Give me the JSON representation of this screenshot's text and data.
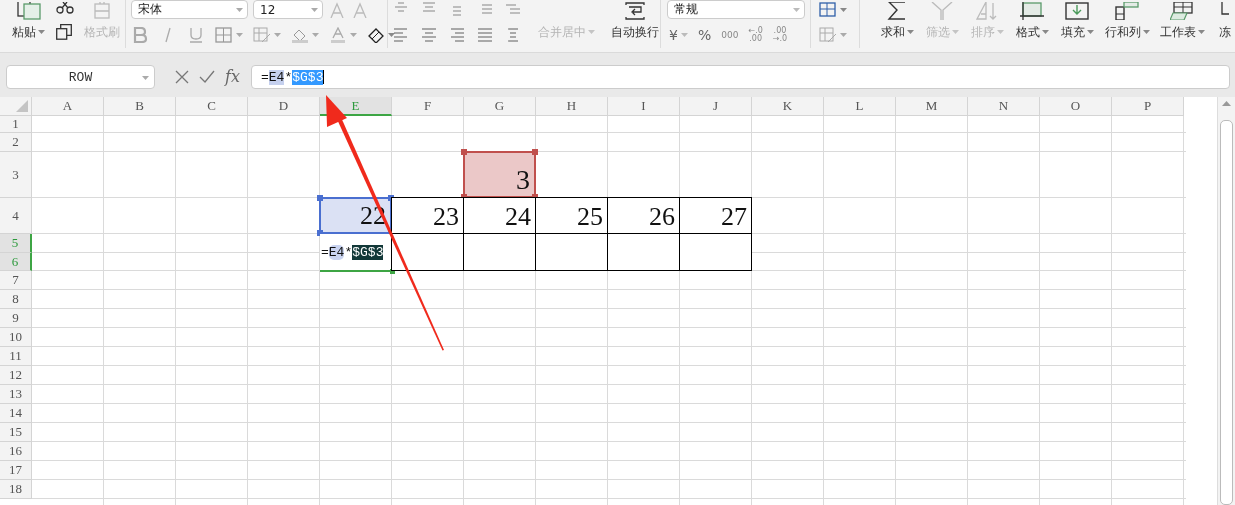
{
  "ribbon": {
    "clipboard": {
      "paste": {
        "label": "粘贴",
        "dropdown": true,
        "disabled": false
      },
      "format_painter": {
        "label": "格式刷",
        "dropdown": false,
        "disabled": true
      }
    },
    "font": {
      "name": "宋体",
      "size": "12"
    },
    "alignment": {
      "merge_center": {
        "label": "合并居中",
        "dropdown": true,
        "disabled": true
      },
      "wrap_text": {
        "label": "自动换行",
        "dropdown": false,
        "disabled": false
      }
    },
    "number": {
      "format": "常规",
      "currency": "¥",
      "percent": "%",
      "thousands": "000",
      "increase_decimal": {
        "top": "←.0",
        "bottom": ".00"
      },
      "decrease_decimal": {
        "top": ".00",
        "bottom": "→.0"
      }
    },
    "editing": [
      {
        "label": "求和",
        "dropdown": true,
        "disabled": false
      },
      {
        "label": "筛选",
        "dropdown": true,
        "disabled": true
      },
      {
        "label": "排序",
        "dropdown": true,
        "disabled": true
      },
      {
        "label": "格式",
        "dropdown": true,
        "disabled": false
      },
      {
        "label": "填充",
        "dropdown": true,
        "disabled": false
      },
      {
        "label": "行和列",
        "dropdown": true,
        "disabled": false
      },
      {
        "label": "工作表",
        "dropdown": true,
        "disabled": false
      },
      {
        "label": "冻",
        "dropdown": false,
        "disabled": false
      }
    ]
  },
  "formula_bar": {
    "name_box": "ROW",
    "function_label": "fx",
    "segments": [
      {
        "text": "=",
        "kind": "plain"
      },
      {
        "text": "E4",
        "kind": "ref",
        "color": "#c5d0ee"
      },
      {
        "text": "*",
        "kind": "plain"
      },
      {
        "text": "$G$3",
        "kind": "selected",
        "color": "#3399ff"
      }
    ]
  },
  "sheet": {
    "columns": [
      {
        "label": "A",
        "selected": false
      },
      {
        "label": "B",
        "selected": false
      },
      {
        "label": "C",
        "selected": false
      },
      {
        "label": "D",
        "selected": false
      },
      {
        "label": "E",
        "selected": true
      },
      {
        "label": "F",
        "selected": false
      },
      {
        "label": "G",
        "selected": false
      },
      {
        "label": "H",
        "selected": false
      },
      {
        "label": "I",
        "selected": false
      },
      {
        "label": "J",
        "selected": false
      },
      {
        "label": "K",
        "selected": false
      },
      {
        "label": "L",
        "selected": false
      },
      {
        "label": "M",
        "selected": false
      },
      {
        "label": "N",
        "selected": false
      },
      {
        "label": "O",
        "selected": false
      },
      {
        "label": "P",
        "selected": false
      }
    ],
    "rows": [
      {
        "label": "1",
        "selected": false
      },
      {
        "label": "2",
        "selected": false
      },
      {
        "label": "3",
        "selected": false,
        "cells": [
          {
            "kind": "empty"
          },
          {
            "kind": "empty"
          },
          {
            "kind": "empty"
          },
          {
            "kind": "empty"
          },
          {
            "kind": "empty"
          },
          {
            "kind": "empty"
          },
          {
            "kind": "ref_target",
            "value": "3"
          }
        ]
      },
      {
        "label": "4",
        "selected": false,
        "cells": [
          {
            "kind": "empty"
          },
          {
            "kind": "empty"
          },
          {
            "kind": "empty"
          },
          {
            "kind": "empty"
          },
          {
            "kind": "ref_source",
            "value": "22"
          },
          {
            "kind": "bordered",
            "value": "23"
          },
          {
            "kind": "bordered",
            "value": "24"
          },
          {
            "kind": "bordered",
            "value": "25"
          },
          {
            "kind": "bordered",
            "value": "26"
          },
          {
            "kind": "bordered",
            "value": "27"
          }
        ]
      },
      {
        "label": "5",
        "selected": true,
        "cells": [
          {
            "kind": "empty"
          },
          {
            "kind": "empty"
          },
          {
            "kind": "empty"
          },
          {
            "kind": "empty"
          },
          {
            "kind": "editing",
            "merged_down": true,
            "segments": [
              {
                "text": "=",
                "kind": "plain"
              },
              {
                "text": "E4",
                "kind": "ref",
                "color": "#c9d3f0"
              },
              {
                "text": "*",
                "kind": "plain"
              },
              {
                "text": "$G$3",
                "kind": "selected",
                "color": "#123838"
              }
            ]
          },
          {
            "kind": "bordered",
            "merged_down": true
          },
          {
            "kind": "bordered",
            "merged_down": true
          },
          {
            "kind": "bordered",
            "merged_down": true
          },
          {
            "kind": "bordered",
            "merged_down": true
          },
          {
            "kind": "bordered",
            "merged_down": true
          }
        ]
      },
      {
        "label": "6",
        "selected": true
      },
      {
        "label": "7",
        "selected": false
      },
      {
        "label": "8",
        "selected": false
      },
      {
        "label": "9",
        "selected": false
      },
      {
        "label": "10",
        "selected": false
      },
      {
        "label": "11",
        "selected": false
      },
      {
        "label": "12",
        "selected": false
      },
      {
        "label": "13",
        "selected": false
      },
      {
        "label": "14",
        "selected": false
      },
      {
        "label": "15",
        "selected": false
      },
      {
        "label": "16",
        "selected": false
      },
      {
        "label": "17",
        "selected": false
      },
      {
        "label": "18",
        "selected": false
      }
    ]
  },
  "annotation_arrow": {
    "color": "#f02a1c"
  }
}
